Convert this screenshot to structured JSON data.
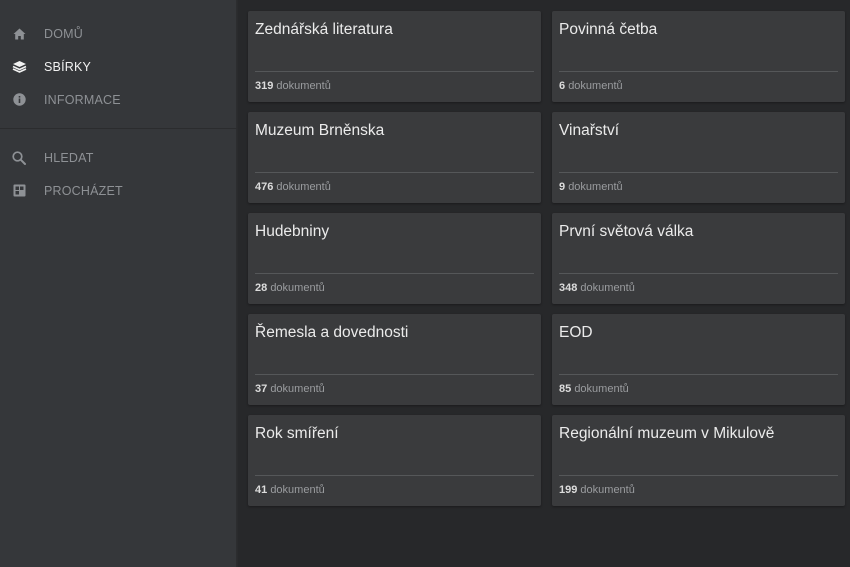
{
  "sidebar": {
    "primary": [
      {
        "label": "DOMŮ",
        "icon": "home-icon"
      },
      {
        "label": "SBÍRKY",
        "icon": "books-icon",
        "active": true
      },
      {
        "label": "INFORMACE",
        "icon": "info-icon"
      }
    ],
    "secondary": [
      {
        "label": "HLEDAT",
        "icon": "search-icon"
      },
      {
        "label": "PROCHÁZET",
        "icon": "browse-icon"
      }
    ]
  },
  "collections": [
    {
      "title": "Zednářská literatura",
      "count": "319",
      "unit": "dokumentů"
    },
    {
      "title": "Povinná četba",
      "count": "6",
      "unit": "dokumentů"
    },
    {
      "title": "Muzeum Brněnska",
      "count": "476",
      "unit": "dokumentů"
    },
    {
      "title": "Vinařství",
      "count": "9",
      "unit": "dokumentů"
    },
    {
      "title": "Hudebniny",
      "count": "28",
      "unit": "dokumentů"
    },
    {
      "title": "První světová válka",
      "count": "348",
      "unit": "dokumentů"
    },
    {
      "title": "Řemesla a dovednosti",
      "count": "37",
      "unit": "dokumentů"
    },
    {
      "title": "EOD",
      "count": "85",
      "unit": "dokumentů"
    },
    {
      "title": "Rok smíření",
      "count": "41",
      "unit": "dokumentů"
    },
    {
      "title": "Regionální muzeum v Mikulově",
      "count": "199",
      "unit": "dokumentů"
    }
  ],
  "colors": {
    "sidebar_bg": "#35373a",
    "main_bg": "#27282a",
    "card_bg": "#3a3b3d",
    "text_active": "#f2f2f2",
    "text_muted": "#8e9195"
  }
}
